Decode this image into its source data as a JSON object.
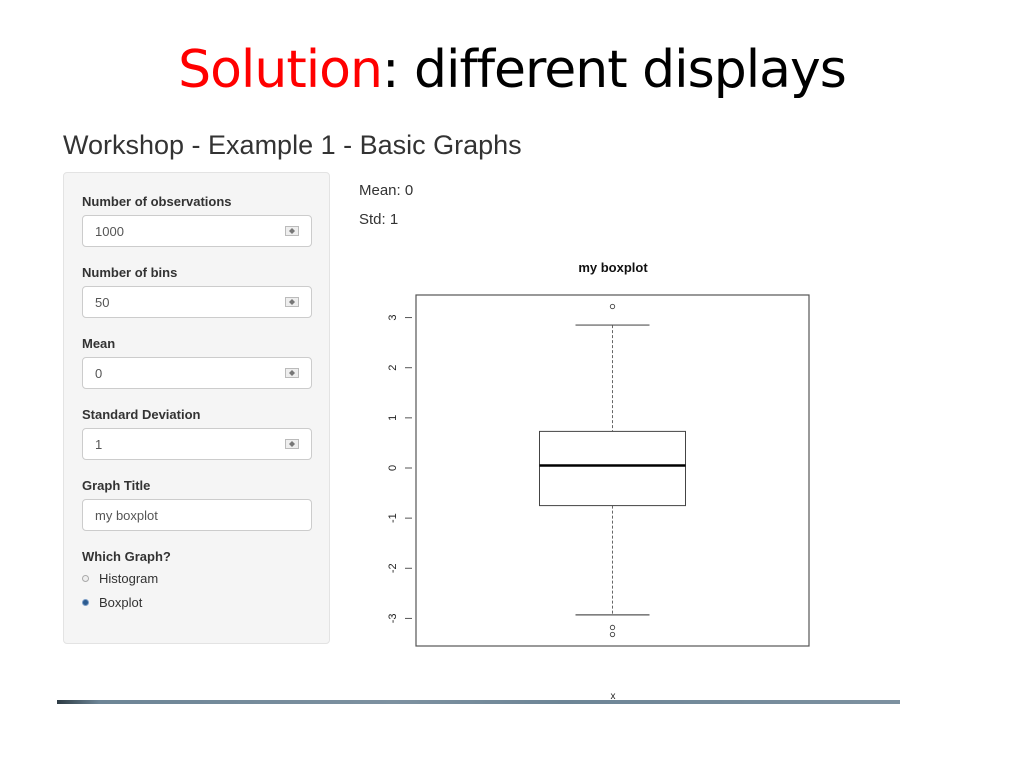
{
  "slide": {
    "title_accent": "Solution",
    "title_rest": ": different displays",
    "accent_color": "#ff0000"
  },
  "app": {
    "title": "Workshop - Example 1 - Basic Graphs"
  },
  "sidebar": {
    "fields": [
      {
        "label": "Number of observations",
        "value": "1000",
        "type": "numeric"
      },
      {
        "label": "Number of bins",
        "value": "50",
        "type": "numeric"
      },
      {
        "label": "Mean",
        "value": "0",
        "type": "numeric"
      },
      {
        "label": "Standard Deviation",
        "value": "1",
        "type": "numeric"
      },
      {
        "label": "Graph Title",
        "value": "my boxplot",
        "type": "text"
      }
    ],
    "radio_group": {
      "label": "Which Graph?",
      "options": [
        {
          "label": "Histogram",
          "checked": false
        },
        {
          "label": "Boxplot",
          "checked": true
        }
      ]
    }
  },
  "main": {
    "mean_text": "Mean: 0",
    "std_text": "Std: 1"
  },
  "chart_data": {
    "type": "boxplot",
    "title": "my boxplot",
    "xlabel": "x",
    "ylabel": "",
    "ylim": [
      -3.55,
      3.45
    ],
    "yticks": [
      3,
      2,
      1,
      0,
      -1,
      -2,
      -3
    ],
    "ytick_labels": [
      "3",
      "2",
      "1",
      "0",
      "-1",
      "-2",
      "-3"
    ],
    "stats": {
      "whisker_high": 2.85,
      "q3": 0.73,
      "median": 0.05,
      "q1": -0.75,
      "whisker_low": -2.93
    },
    "outliers": [
      3.22,
      -3.18,
      -3.32
    ]
  }
}
